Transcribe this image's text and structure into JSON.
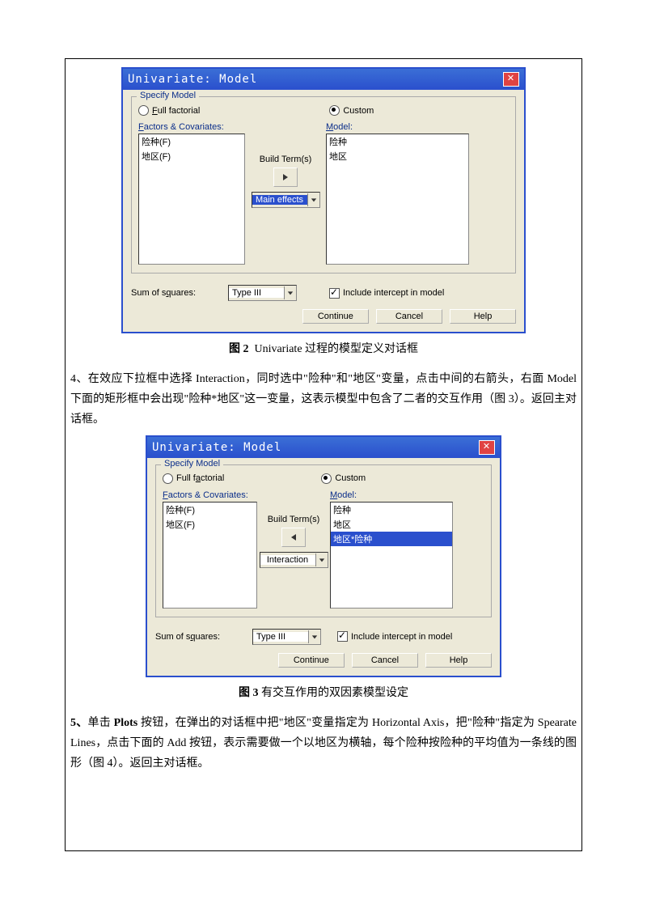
{
  "dialog1": {
    "title": "Univariate: Model",
    "group_label": "Specify Model",
    "radio_full": "Full factorial",
    "radio_custom": "Custom",
    "factors_label": "Factors & Covariates:",
    "model_label": "Model:",
    "factors_items": [
      "险种(F)",
      "地区(F)"
    ],
    "model_items": [
      "险种",
      "地区"
    ],
    "build_terms_label": "Build Term(s)",
    "combo_value": "Main effects",
    "sum_sq_label": "Sum of squares:",
    "sum_sq_value": "Type III",
    "include_intercept": "Include intercept in model",
    "btn_continue": "Continue",
    "btn_cancel": "Cancel",
    "btn_help": "Help"
  },
  "caption1_bold": "图 2",
  "caption1_rest": "Univariate 过程的模型定义对话框",
  "para4": "4、在效应下拉框中选择 Interaction，同时选中\"险种\"和\"地区\"变量，点击中间的右箭头，右面 Model 下面的矩形框中会出现\"险种*地区\"这一变量，这表示模型中包含了二者的交互作用（图 3）。返回主对话框。",
  "dialog2": {
    "title": "Univariate: Model",
    "group_label": "Specify Model",
    "radio_full": "Full factorial",
    "radio_custom": "Custom",
    "factors_label": "Factors & Covariates:",
    "model_label": "Model:",
    "factors_items": [
      "险种(F)",
      "地区(F)"
    ],
    "model_items": [
      "险种",
      "地区",
      "地区*险种"
    ],
    "build_terms_label": "Build Term(s)",
    "combo_value": "Interaction",
    "sum_sq_label": "Sum of squares:",
    "sum_sq_value": "Type III",
    "include_intercept": "Include intercept in model",
    "btn_continue": "Continue",
    "btn_cancel": "Cancel",
    "btn_help": "Help"
  },
  "caption2_bold": "图 3",
  "caption2_rest": "有交互作用的双因素模型设定",
  "para5": "5、单击 Plots 按钮，在弹出的对话框中把\"地区\"变量指定为 Horizontal Axis，把\"险种\"指定为 Spearate Lines，点击下面的 Add 按钮，表示需要做一个以地区为横轴，每个险种按险种的平均值为一条线的图形（图 4）。返回主对话框。"
}
